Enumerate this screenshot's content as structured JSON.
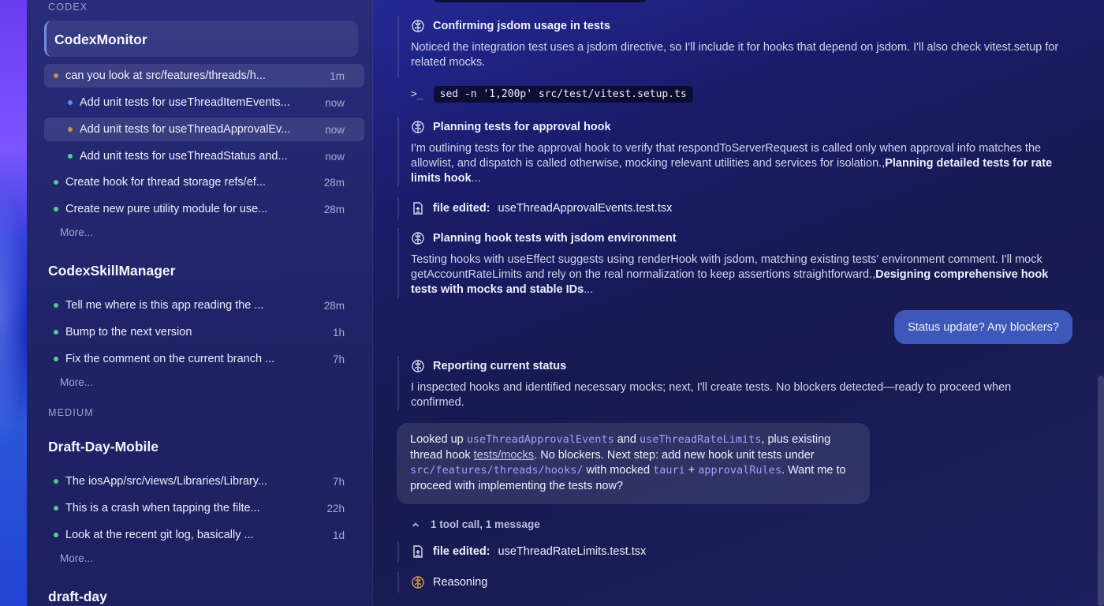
{
  "colors": {
    "dot_orange": "#c98a5e",
    "dot_blue": "#5a8cff",
    "dot_green": "#4fd08a",
    "accent_user_bubble": "#3d58b8",
    "code_highlight": "#a79cff"
  },
  "sidebar": {
    "sections": {
      "codex": "CODEX",
      "medium": "MEDIUM"
    },
    "workspaces": {
      "codexmonitor": {
        "title": "CodexMonitor",
        "threads": [
          {
            "label": "can you look at src/features/threads/h...",
            "time": "1m",
            "dot": "orange"
          },
          {
            "label": "Add unit tests for useThreadItemEvents...",
            "time": "now",
            "dot": "blue"
          },
          {
            "label": "Add unit tests for useThreadApprovalEv...",
            "time": "now",
            "dot": "orange"
          },
          {
            "label": "Add unit tests for useThreadStatus and...",
            "time": "now",
            "dot": "green"
          },
          {
            "label": "Create hook for thread storage refs/ef...",
            "time": "28m",
            "dot": "green"
          },
          {
            "label": "Create new pure utility module for use...",
            "time": "28m",
            "dot": "green"
          }
        ],
        "more": "More..."
      },
      "codexskillmanager": {
        "title": "CodexSkillManager",
        "threads": [
          {
            "label": "Tell me where is this app reading the ...",
            "time": "28m",
            "dot": "green"
          },
          {
            "label": "Bump to the next version",
            "time": "1h",
            "dot": "green"
          },
          {
            "label": "Fix the comment on the current branch ...",
            "time": "7h",
            "dot": "green"
          }
        ],
        "more": "More..."
      },
      "draftdaymobile": {
        "title": "Draft-Day-Mobile",
        "threads": [
          {
            "label": "The iosApp/src/views/Libraries/Library...",
            "time": "7h",
            "dot": "green"
          },
          {
            "label": "This is a crash when tapping the filte...",
            "time": "22h",
            "dot": "green"
          },
          {
            "label": "Look at the recent git log, basically ...",
            "time": "1d",
            "dot": "green"
          }
        ],
        "more": "More..."
      },
      "draftday": {
        "title": "draft-day"
      }
    }
  },
  "conversation": {
    "r1": {
      "title": "Confirming jsdom usage in tests",
      "body": "Noticed the integration test uses a jsdom directive, so I'll include it for hooks that depend on jsdom. I'll also check vitest.setup for related mocks."
    },
    "cmd1": {
      "prompt": ">_",
      "code": "sed -n '1,200p' src/test/vitest.setup.ts"
    },
    "r2": {
      "title": "Planning tests for approval hook",
      "body": "I'm outlining tests for the approval hook to verify that respondToServerRequest is called only when approval info matches the allowlist, and dispatch is called otherwise, mocking relevant utilities and services for isolation.,",
      "bold": "Planning detailed tests for rate limits hook",
      "ellipsis": "..."
    },
    "file1": {
      "label": "file edited:",
      "name": "useThreadApprovalEvents.test.tsx"
    },
    "r3": {
      "title": "Planning hook tests with jsdom environment",
      "body": "Testing hooks with useEffect suggests using renderHook with jsdom, matching existing tests' environment comment. I'll mock getAccountRateLimits and rely on the real normalization to keep assertions straightforward.,",
      "bold": "Designing comprehensive hook tests with mocks and stable IDs",
      "ellipsis": "..."
    },
    "user_message": "Status update? Any blockers?",
    "r4": {
      "title": "Reporting current status",
      "body": "I inspected hooks and identified necessary mocks; next, I'll create tests. No blockers detected—ready to proceed when confirmed."
    },
    "assistant": {
      "t1": "Looked up ",
      "c1": "useThreadApprovalEvents",
      "t2": " and ",
      "c2": "useThreadRateLimits",
      "t3": ", plus existing thread hook ",
      "link": "tests/mocks",
      "t4": ". No blockers. Next step: add new hook unit tests under ",
      "c3": "src/features/threads/hooks/",
      "t5": " with mocked ",
      "c4": "tauri",
      "t6": " + ",
      "c5": "approvalRules",
      "t7": ". Want me to proceed with implementing the tests now?"
    },
    "collapse": "1 tool call, 1 message",
    "file2": {
      "label": "file edited:",
      "name": "useThreadRateLimits.test.tsx"
    },
    "reasoning": "Reasoning"
  }
}
